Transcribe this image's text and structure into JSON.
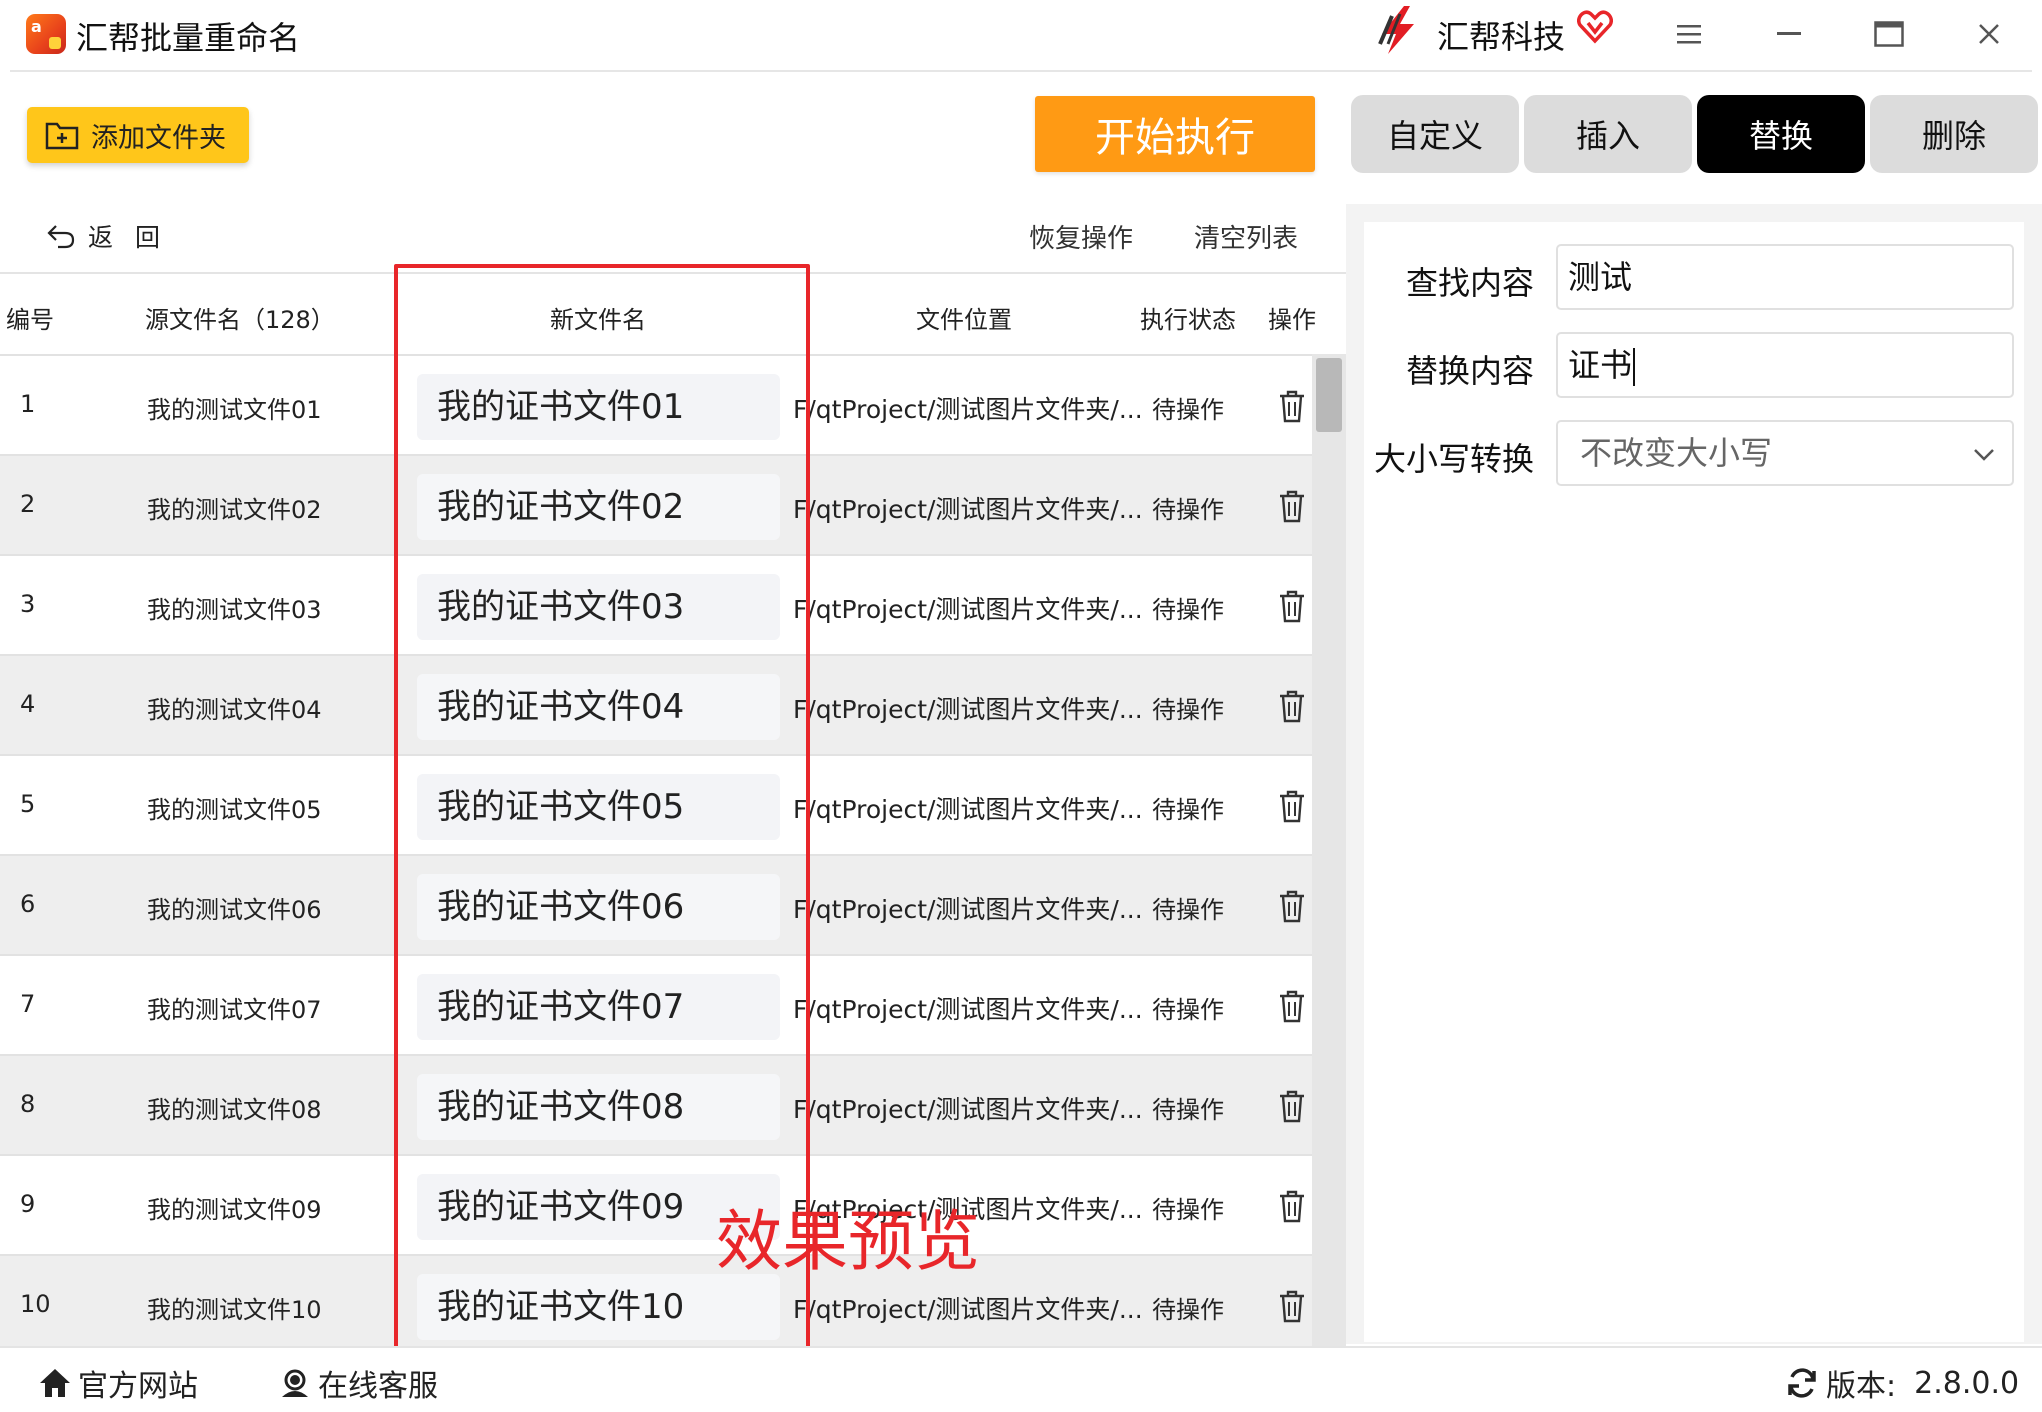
{
  "app": {
    "title": "汇帮批量重命名",
    "icon": "app-logo-icon",
    "icon_text": "a"
  },
  "brand": {
    "name": "汇帮科技",
    "logo": "brand-logo-icon",
    "vip_icon": "heart-vip-icon"
  },
  "window_controls": [
    "menu-icon",
    "minimize-icon",
    "maximize-icon",
    "close-icon"
  ],
  "toolbar": {
    "add_folder_label": "添加文件夹",
    "start_label": "开始执行"
  },
  "mode_tabs": [
    {
      "label": "自定义",
      "active": false
    },
    {
      "label": "插入",
      "active": false
    },
    {
      "label": "替换",
      "active": true
    },
    {
      "label": "删除",
      "active": false
    }
  ],
  "list_actions": {
    "back_label": "返回",
    "restore_label": "恢复操作",
    "clear_label": "清空列表"
  },
  "table": {
    "headers": {
      "num": "编号",
      "source": "源文件名（128）",
      "new_name": "新文件名",
      "location": "文件位置",
      "status": "执行状态",
      "action": "操作"
    },
    "rows": [
      {
        "num": "1",
        "source": "我的测试文件01",
        "new_name": "我的证书文件01",
        "location": "F/qtProject/测试图片文件夹/...",
        "status": "待操作"
      },
      {
        "num": "2",
        "source": "我的测试文件02",
        "new_name": "我的证书文件02",
        "location": "F/qtProject/测试图片文件夹/...",
        "status": "待操作"
      },
      {
        "num": "3",
        "source": "我的测试文件03",
        "new_name": "我的证书文件03",
        "location": "F/qtProject/测试图片文件夹/...",
        "status": "待操作"
      },
      {
        "num": "4",
        "source": "我的测试文件04",
        "new_name": "我的证书文件04",
        "location": "F/qtProject/测试图片文件夹/...",
        "status": "待操作"
      },
      {
        "num": "5",
        "source": "我的测试文件05",
        "new_name": "我的证书文件05",
        "location": "F/qtProject/测试图片文件夹/...",
        "status": "待操作"
      },
      {
        "num": "6",
        "source": "我的测试文件06",
        "new_name": "我的证书文件06",
        "location": "F/qtProject/测试图片文件夹/...",
        "status": "待操作"
      },
      {
        "num": "7",
        "source": "我的测试文件07",
        "new_name": "我的证书文件07",
        "location": "F/qtProject/测试图片文件夹/...",
        "status": "待操作"
      },
      {
        "num": "8",
        "source": "我的测试文件08",
        "new_name": "我的证书文件08",
        "location": "F/qtProject/测试图片文件夹/...",
        "status": "待操作"
      },
      {
        "num": "9",
        "source": "我的测试文件09",
        "new_name": "我的证书文件09",
        "location": "F/qtProject/测试图片文件夹/...",
        "status": "待操作"
      },
      {
        "num": "10",
        "source": "我的测试文件10",
        "new_name": "我的证书文件10",
        "location": "F/qtProject/测试图片文件夹/...",
        "status": "待操作"
      }
    ]
  },
  "annotation": {
    "preview_label": "效果预览",
    "color": "#e8262a"
  },
  "replace_panel": {
    "find_label": "查找内容",
    "find_value": "测试",
    "replace_label": "替换内容",
    "replace_value": "证书",
    "case_label": "大小写转换",
    "case_value": "不改变大小写"
  },
  "footer": {
    "website_label": "官方网站",
    "support_label": "在线客服",
    "version_label": "版本:",
    "version_value": "2.8.0.0"
  },
  "colors": {
    "accent_orange": "#ff9a14",
    "add_folder_yellow": "#ffc61a",
    "active_tab": "#000000",
    "inactive_tab": "#dcdcdc"
  }
}
